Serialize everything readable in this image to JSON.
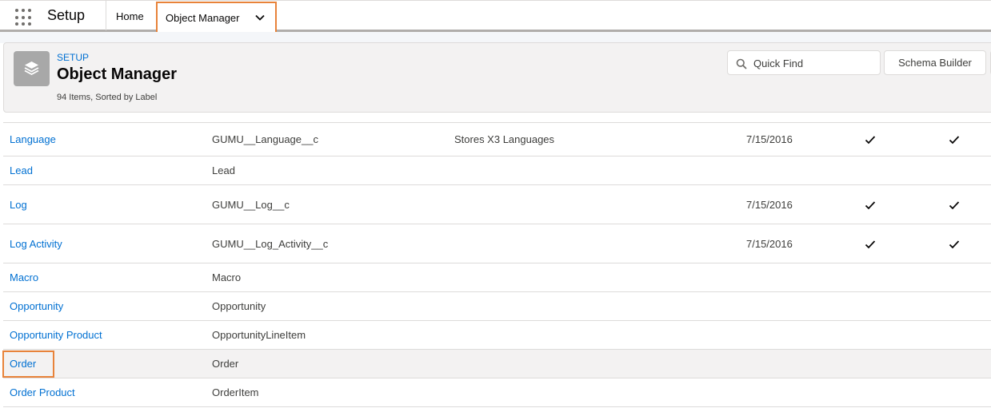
{
  "nav": {
    "app_name": "Setup",
    "home_label": "Home",
    "active_tab_label": "Object Manager"
  },
  "header": {
    "eyebrow": "SETUP",
    "title": "Object Manager",
    "subtitle": "94 Items, Sorted by Label",
    "quickfind_placeholder": "Quick Find",
    "schema_builder_label": "Schema Builder"
  },
  "rows": [
    {
      "label": "Language",
      "api": "GUMU__Language__c",
      "desc": "Stores X3 Languages",
      "date": "7/15/2016",
      "check1": true,
      "check2": true
    },
    {
      "label": "Lead",
      "api": "Lead",
      "desc": "",
      "date": "",
      "check1": false,
      "check2": false
    },
    {
      "label": "Log",
      "api": "GUMU__Log__c",
      "desc": "",
      "date": "7/15/2016",
      "check1": true,
      "check2": true
    },
    {
      "label": "Log Activity",
      "api": "GUMU__Log_Activity__c",
      "desc": "",
      "date": "7/15/2016",
      "check1": true,
      "check2": true
    },
    {
      "label": "Macro",
      "api": "Macro",
      "desc": "",
      "date": "",
      "check1": false,
      "check2": false
    },
    {
      "label": "Opportunity",
      "api": "Opportunity",
      "desc": "",
      "date": "",
      "check1": false,
      "check2": false
    },
    {
      "label": "Opportunity Product",
      "api": "OpportunityLineItem",
      "desc": "",
      "date": "",
      "check1": false,
      "check2": false
    },
    {
      "label": "Order",
      "api": "Order",
      "desc": "",
      "date": "",
      "check1": false,
      "check2": false
    },
    {
      "label": "Order Product",
      "api": "OrderItem",
      "desc": "",
      "date": "",
      "check1": false,
      "check2": false
    }
  ],
  "colors": {
    "link": "#0070d2",
    "highlight_outline": "#e8833a"
  }
}
